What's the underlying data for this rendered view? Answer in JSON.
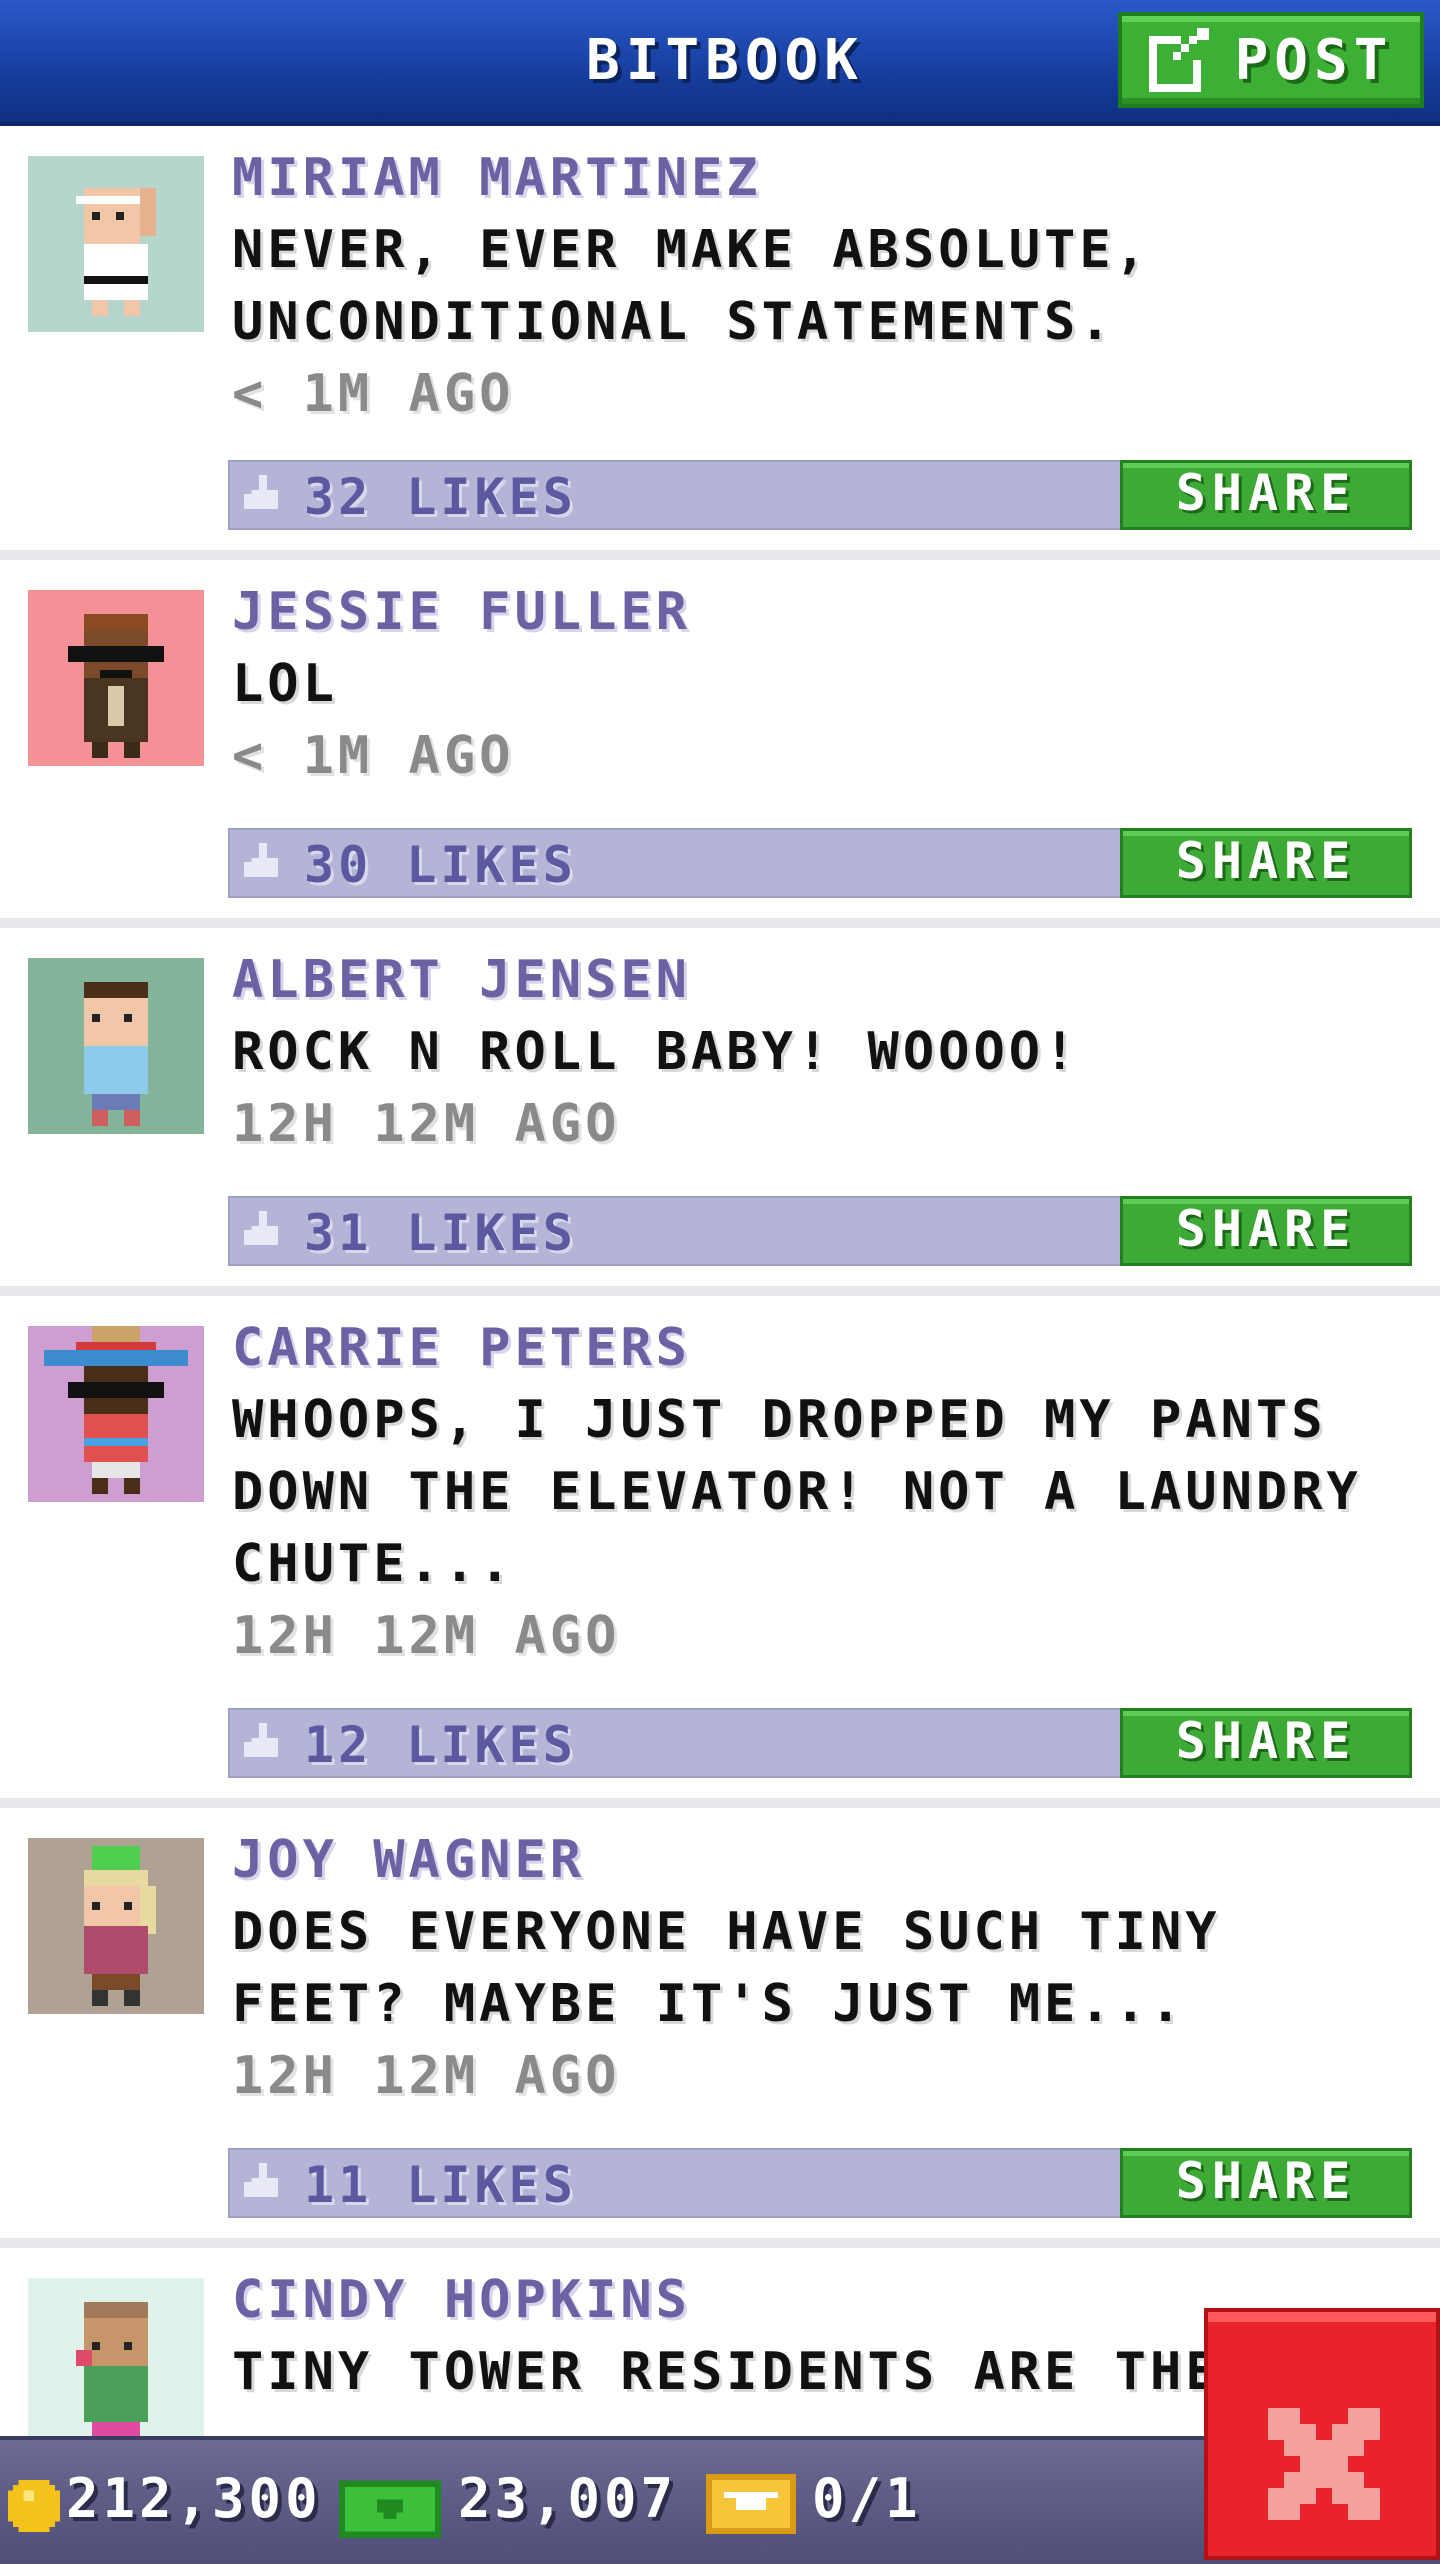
{
  "header": {
    "title": "BITBOOK",
    "post_label": "POST"
  },
  "posts": [
    {
      "author": "MIRIAM MARTINEZ",
      "message": "NEVER, EVER MAKE ABSOLUTE, UNCONDITIONAL STATEMENTS.",
      "time": "< 1M AGO",
      "likes": "32 LIKES",
      "share": "SHARE",
      "avatar_bg": "#b6d5cd"
    },
    {
      "author": "JESSIE FULLER",
      "message": "LOL",
      "time": "< 1M AGO",
      "likes": "30 LIKES",
      "share": "SHARE",
      "avatar_bg": "#f39196"
    },
    {
      "author": "ALBERT JENSEN",
      "message": "ROCK N ROLL BABY! WOOOO!",
      "time": "12H 12M AGO",
      "likes": "31 LIKES",
      "share": "SHARE",
      "avatar_bg": "#84b49a"
    },
    {
      "author": "CARRIE PETERS",
      "message": "WHOOPS, I JUST DROPPED MY PANTS DOWN THE ELEVATOR! NOT A LAUNDRY CHUTE...",
      "time": "12H 12M AGO",
      "likes": "12 LIKES",
      "share": "SHARE",
      "avatar_bg": "#cf9ed0"
    },
    {
      "author": "JOY WAGNER",
      "message": "DOES EVERYONE HAVE SUCH TINY FEET? MAYBE IT'S JUST ME...",
      "time": "12H 12M AGO",
      "likes": "11 LIKES",
      "share": "SHARE",
      "avatar_bg": "#b0a293"
    },
    {
      "author": "CINDY HOPKINS",
      "message": "TINY TOWER RESIDENTS ARE THE",
      "avatar_bg": "#dff3ea"
    }
  ],
  "bottom": {
    "coins": "212,300",
    "bux": "23,007",
    "tickets": "0/1"
  },
  "colors": {
    "header": "#1f4bb6",
    "accent_green": "#3cb034",
    "likes_bar": "#b4b4d6",
    "close_red": "#e8232a"
  }
}
